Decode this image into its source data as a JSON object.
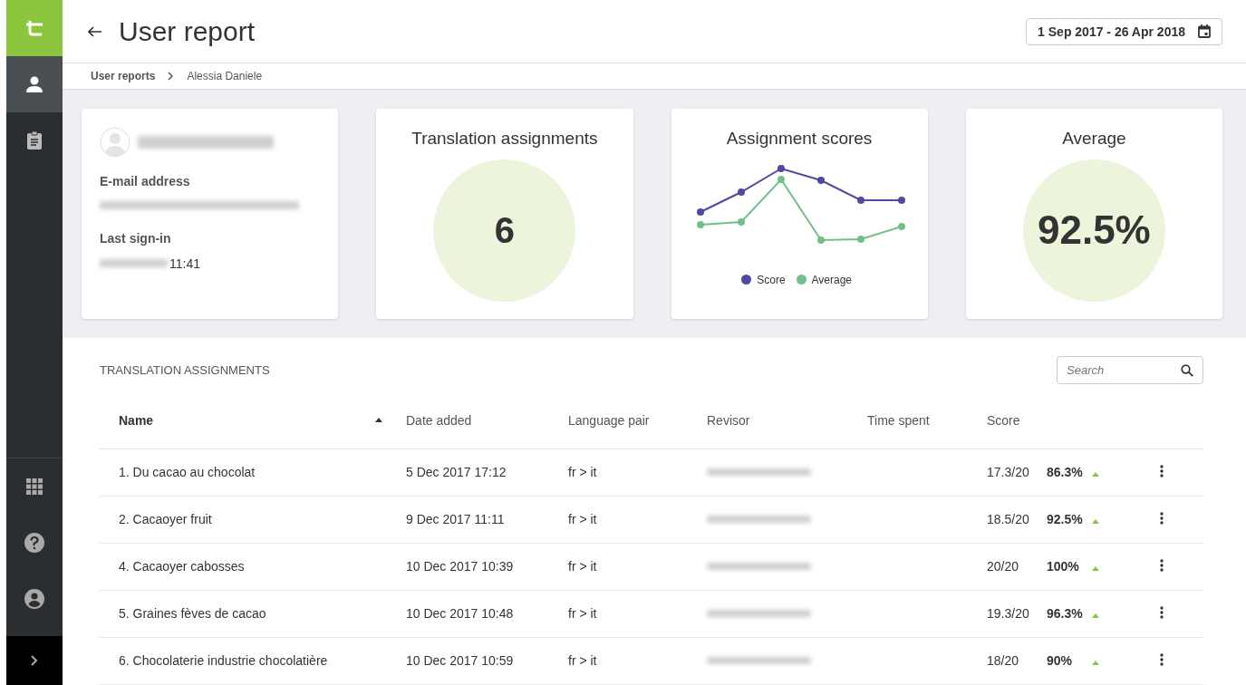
{
  "sidebar": {
    "top_items": [
      {
        "selected": true
      },
      {
        "selected": false
      }
    ],
    "bottom_items": [
      {
        "selected": false
      },
      {
        "selected": false
      },
      {
        "selected": false
      }
    ]
  },
  "header": {
    "title": "User report",
    "date_range": "1 Sep 2017 - 26 Apr 2018"
  },
  "breadcrumb": [
    "User reports",
    "Alessia Daniele"
  ],
  "profile": {
    "email_label": "E-mail address",
    "last_sign_in_label": "Last sign-in",
    "last_sign_in_time": "11:41"
  },
  "assignments_card": {
    "title": "Translation assignments",
    "value": "6"
  },
  "scores_card": {
    "title": "Assignment scores",
    "legend": [
      {
        "label": "Score",
        "color": "#4f4aa0"
      },
      {
        "label": "Average",
        "color": "#6fc08a"
      }
    ]
  },
  "average_card": {
    "title": "Average",
    "value": "92.5%"
  },
  "table": {
    "title": "TRANSLATION ASSIGNMENTS",
    "search": {
      "placeholder": "Search"
    },
    "columns": [
      {
        "label": "Name",
        "sorted": true
      },
      {
        "label": "Date added",
        "sorted": false
      },
      {
        "label": "Language pair",
        "sorted": false
      },
      {
        "label": "Revisor",
        "sorted": false
      },
      {
        "label": "Time spent",
        "sorted": false
      },
      {
        "label": "Score",
        "sorted": false
      }
    ],
    "rows": [
      {
        "name": "1. Du cacao au chocolat",
        "date": "5 Dec 2017 17:12",
        "pair": "fr > it",
        "score": "17.3/20",
        "percent": "86.3%"
      },
      {
        "name": "2. Cacaoyer fruit",
        "date": "9 Dec 2017 11:11",
        "pair": "fr > it",
        "score": "18.5/20",
        "percent": "92.5%"
      },
      {
        "name": "4. Cacaoyer cabosses",
        "date": "10 Dec 2017 10:39",
        "pair": "fr > it",
        "score": "20/20",
        "percent": "100%"
      },
      {
        "name": "5. Graines fèves de cacao",
        "date": "10 Dec 2017 10:48",
        "pair": "fr > it",
        "score": "19.3/20",
        "percent": "96.3%"
      },
      {
        "name": "6. Chocolaterie industrie chocolatière",
        "date": "10 Dec 2017 10:59",
        "pair": "fr > it",
        "score": "18/20",
        "percent": "90%"
      }
    ]
  }
}
